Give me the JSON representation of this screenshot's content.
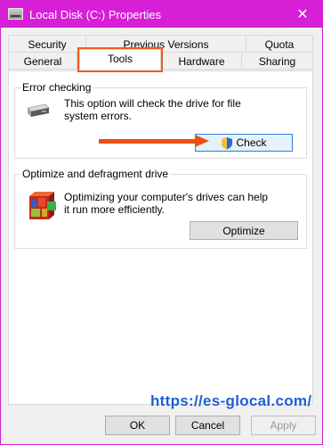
{
  "window": {
    "title": "Local Disk (C:) Properties",
    "close_glyph": "✕"
  },
  "tabs": {
    "row1": [
      "Security",
      "Previous Versions",
      "Quota"
    ],
    "row2": [
      "General",
      "Tools",
      "Hardware",
      "Sharing"
    ],
    "active": "Tools"
  },
  "error_checking": {
    "group_label": "Error checking",
    "description": "This option will check the drive for file system errors.",
    "check_button": "Check",
    "drive_icon": "drive-icon",
    "shield_icon": "shield-icon"
  },
  "optimize": {
    "group_label": "Optimize and defragment drive",
    "description": "Optimizing your computer's drives can help it run more efficiently.",
    "optimize_button": "Optimize",
    "defrag_icon": "defrag-icon"
  },
  "footer": {
    "ok": "OK",
    "cancel": "Cancel",
    "apply": "Apply"
  },
  "watermark": "https://es-glocal.com/",
  "colors": {
    "titlebar": "#d61fd6",
    "annotation": "#ef4e16",
    "watermark": "#1e5fd6"
  }
}
